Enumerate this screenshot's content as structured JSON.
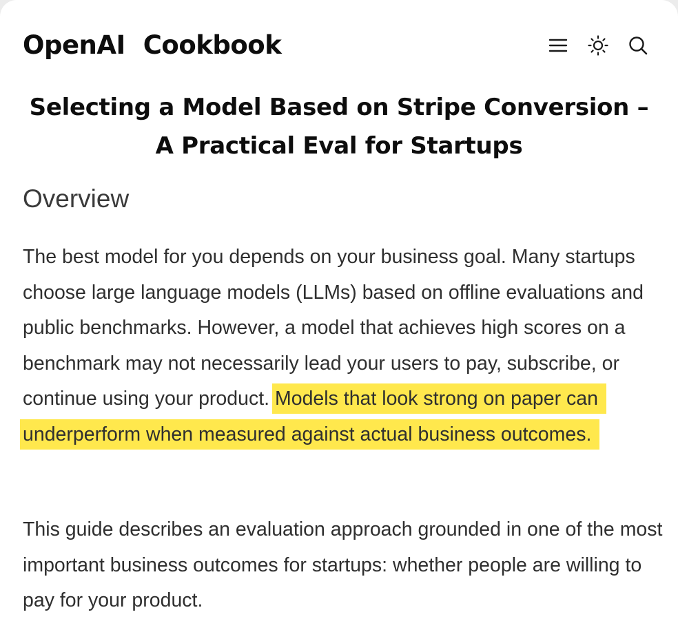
{
  "header": {
    "brand_primary": "OpenAI",
    "brand_secondary": "Cookbook",
    "icons": {
      "menu": "menu-icon",
      "theme": "sun-icon",
      "search": "search-icon"
    }
  },
  "article": {
    "title_line1": "Selecting a Model Based on Stripe Conversion –",
    "title_line2": "A Practical Eval for Startups",
    "section_heading": "Overview",
    "paragraph1_text": "The best model for you depends on your business goal. Many startups choose large language models (LLMs) based on offline evaluations and public benchmarks. However, a model that achieves high scores on a benchmark may not necessarily lead your users to pay, subscribe, or continue using your product.",
    "paragraph1_highlight": "Models that look strong on paper can underperform when measured against actual business outcomes.",
    "paragraph2_text": "This guide describes an evaluation approach grounded in one of the most important business outcomes for startups: whether people are willing to pay for your product."
  },
  "colors": {
    "highlight": "#ffe84d",
    "text": "#2f2f2f",
    "heading": "#0d0d0d"
  }
}
